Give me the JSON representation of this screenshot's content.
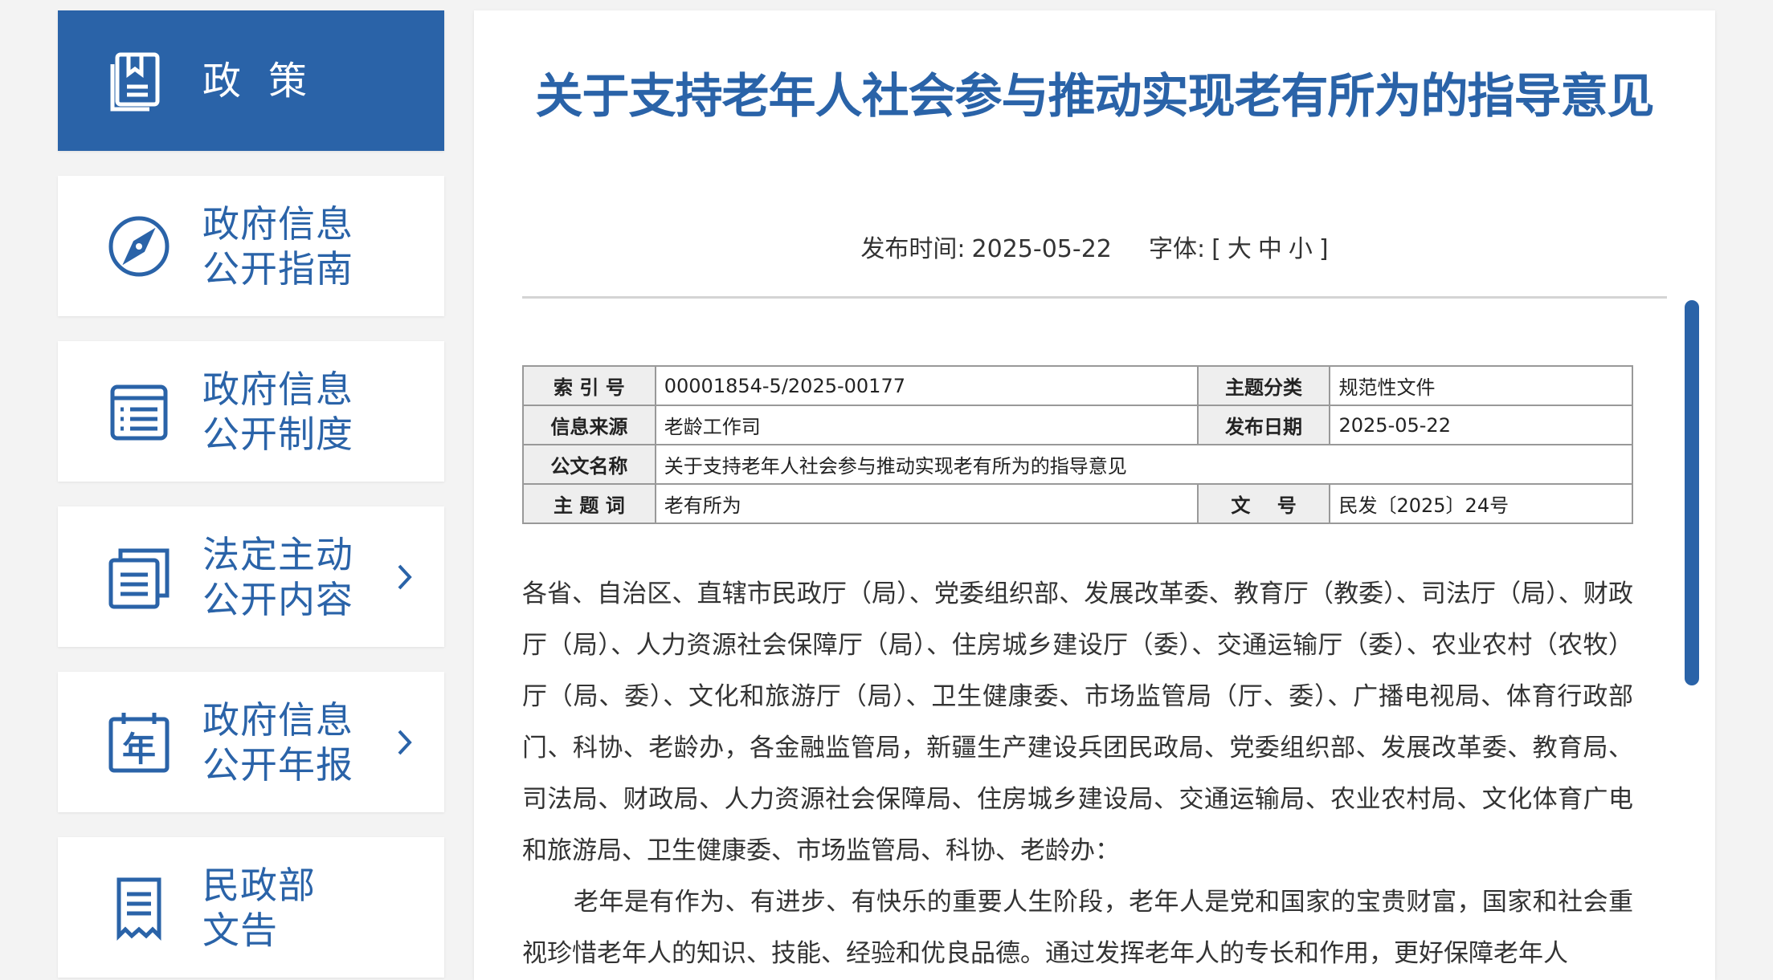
{
  "sidebar": {
    "items": [
      {
        "label": "政策",
        "icon": "document-stack-icon",
        "active": true
      },
      {
        "label": "政府信息\n公开指南",
        "icon": "compass-icon",
        "active": false
      },
      {
        "label": "政府信息\n公开制度",
        "icon": "list-icon",
        "active": false
      },
      {
        "label": "法定主动\n公开内容",
        "icon": "files-icon",
        "active": false,
        "arrow": true
      },
      {
        "label": "政府信息\n公开年报",
        "icon": "calendar-year-icon",
        "active": false,
        "arrow": true
      },
      {
        "label": "民政部\n文告",
        "icon": "receipt-icon",
        "active": false
      }
    ]
  },
  "document": {
    "title": "关于支持老年人社会参与推动实现老有所为的指导意见",
    "publish_label": "发布时间:",
    "publish_date": "2025-05-22",
    "font_label": "字体:",
    "font_open": "[",
    "font_large": "大",
    "font_medium": "中",
    "font_small": "小",
    "font_close": "]"
  },
  "info_table": {
    "index_no_label": "索 引 号",
    "index_no": "00001854-5/2025-00177",
    "topic_label": "主题分类",
    "topic": "规范性文件",
    "source_label": "信息来源",
    "source": "老龄工作司",
    "date_label": "发布日期",
    "date": "2025-05-22",
    "doc_name_label": "公文名称",
    "doc_name": "关于支持老年人社会参与推动实现老有所为的指导意见",
    "keyword_label": "主 题 词",
    "keyword": "老有所为",
    "doc_no_label": "文    号",
    "doc_no": "民发〔2025〕24号"
  },
  "body": {
    "para1": "各省、自治区、直辖市民政厅（局）、党委组织部、发展改革委、教育厅（教委）、司法厅（局）、财政厅（局）、人力资源社会保障厅（局）、住房城乡建设厅（委）、交通运输厅（委）、农业农村（农牧）厅（局、委）、文化和旅游厅（局）、卫生健康委、市场监管局（厅、委）、广播电视局、体育行政部门、科协、老龄办，各金融监管局，新疆生产建设兵团民政局、党委组织部、发展改革委、教育局、司法局、财政局、人力资源社会保障局、住房城乡建设局、交通运输局、农业农村局、文化体育广电和旅游局、卫生健康委、市场监管局、科协、老龄办：",
    "para2": "老年是有作为、有进步、有快乐的重要人生阶段，老年人是党和国家的宝贵财富，国家和社会重视珍惜老年人的知识、技能、经验和优良品德。通过发挥老年人的专长和作用，更好保障老年人"
  },
  "colors": {
    "accent": "#2a63a8",
    "background": "#f3f3f3",
    "table_header": "#eeeeee"
  }
}
